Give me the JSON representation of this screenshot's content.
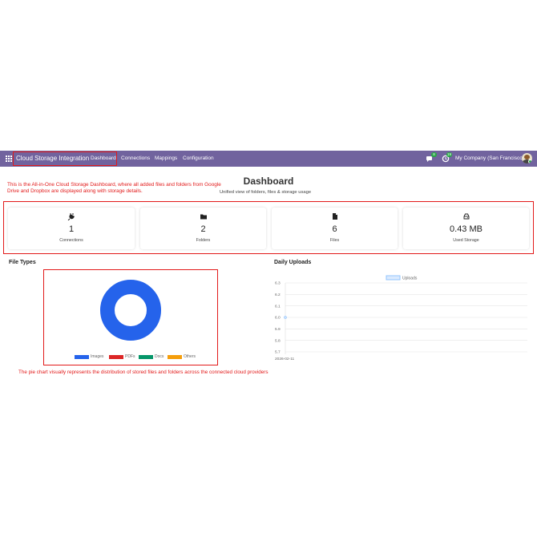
{
  "navbar": {
    "brand": "Cloud Storage Integration",
    "items": [
      "Dashboard",
      "Connections",
      "Mappings",
      "Configuration"
    ],
    "chat_badge": "8",
    "activity_badge": "19",
    "company": "My Company (San Francisco)"
  },
  "annotations": {
    "top": "This is the All-in-One Cloud Storage Dashboard, where all added files and folders from Google Drive and Dropbox are displayed along with storage details.",
    "bottom": "The pie chart visually represents the distribution of stored files and folders across the connected cloud providers"
  },
  "page": {
    "title": "Dashboard",
    "subtitle": "Unified view of folders, files & storage usage"
  },
  "stats": [
    {
      "icon": "plug-icon",
      "value": "1",
      "label": "Connections"
    },
    {
      "icon": "folder-icon",
      "value": "2",
      "label": "Folders"
    },
    {
      "icon": "file-icon",
      "value": "6",
      "label": "Files"
    },
    {
      "icon": "hdd-icon",
      "value": "0.43 MB",
      "label": "Used Storage"
    }
  ],
  "colors": {
    "navbar": "#71639e",
    "annotation_red": "#e21a1a",
    "images": "#2563eb",
    "pdfs": "#dc2626",
    "docs": "#059669",
    "others": "#f59e0b",
    "uploads_line": "#93c5fd"
  },
  "file_types": {
    "title": "File Types",
    "chart_data": {
      "type": "pie",
      "categories": [
        "Images",
        "PDFs",
        "Docs",
        "Others"
      ],
      "values": [
        100,
        0,
        0,
        0
      ],
      "legend": "bottom"
    }
  },
  "daily_uploads": {
    "title": "Daily Uploads",
    "chart_data": {
      "type": "line",
      "x": [
        "2026-02-11"
      ],
      "series": [
        {
          "name": "Uploads",
          "values": [
            6.0
          ]
        }
      ],
      "y_ticks": [
        "6.3",
        "6.2",
        "6.1",
        "6.0",
        "5.9",
        "5.8",
        "5.7"
      ],
      "ylim": [
        5.7,
        6.3
      ],
      "grid": true,
      "legend": "top"
    }
  }
}
